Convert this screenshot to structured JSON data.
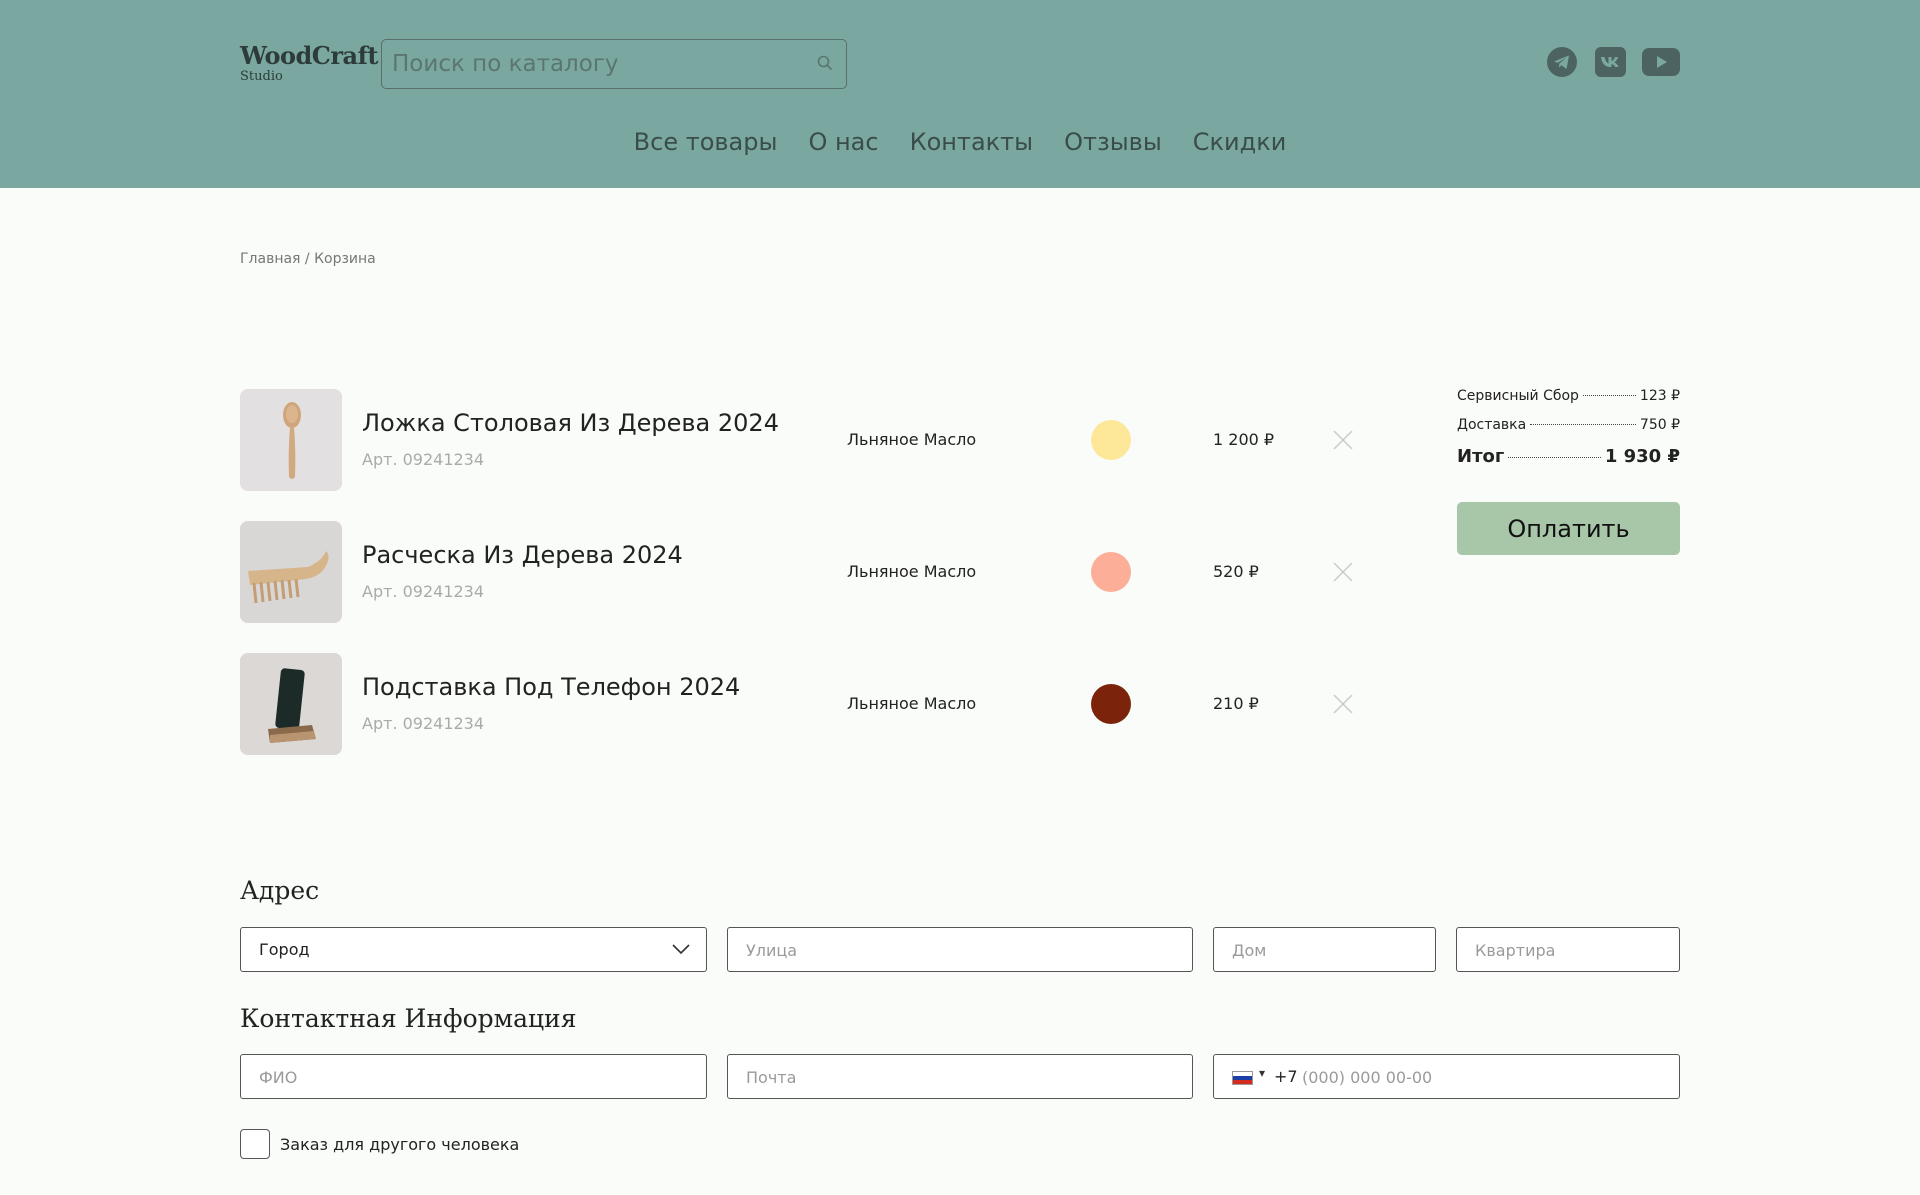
{
  "header": {
    "logo_main": "WoodCraft",
    "logo_sub": "Studio",
    "search_placeholder": "Поиск по каталогу",
    "socials": [
      "telegram-icon",
      "vk-icon",
      "youtube-icon"
    ],
    "nav": [
      "Все товары",
      "О нас",
      "Контакты",
      "Отзывы",
      "Скидки"
    ]
  },
  "breadcrumb": "Главная / Корзина",
  "cart": {
    "items": [
      {
        "name": "Ложка Столовая Из Дерева 2024",
        "article": "Арт. 09241234",
        "finish": "Льняное Масло",
        "color": "#fde89a",
        "price": "1 200  ₽",
        "image": "wooden-spoon"
      },
      {
        "name": "Расческа Из Дерева 2024",
        "article": "Арт. 09241234",
        "finish": "Льняное Масло",
        "color": "#fdae98",
        "price": "520  ₽",
        "image": "wooden-comb"
      },
      {
        "name": "Подставка Под Телефон 2024",
        "article": "Арт. 09241234",
        "finish": "Льняное Масло",
        "color": "#7b230b",
        "price": "210  ₽",
        "image": "phone-stand"
      }
    ]
  },
  "summary": {
    "service_label": "Сервисный Сбор",
    "service_value": "123 ₽",
    "delivery_label": "Доставка",
    "delivery_value": "750 ₽",
    "total_label": "Итог",
    "total_value": "1 930 ₽",
    "pay_label": "Оплатить"
  },
  "address": {
    "title": "Адрес",
    "city_label": "Город",
    "street_placeholder": "Улица",
    "house_placeholder": "Дом",
    "apartment_placeholder": "Квартира"
  },
  "contact": {
    "title": "Контактная Информация",
    "name_placeholder": "ФИО",
    "email_placeholder": "Почта",
    "phone_code": "+7",
    "phone_placeholder": "(000) 000 00-00",
    "other_person_label": "Заказ для другого человека"
  },
  "colors": {
    "header_bg": "#7aa8a0",
    "page_bg": "#f9fcf8",
    "pay_button": "#a8c7a8"
  }
}
